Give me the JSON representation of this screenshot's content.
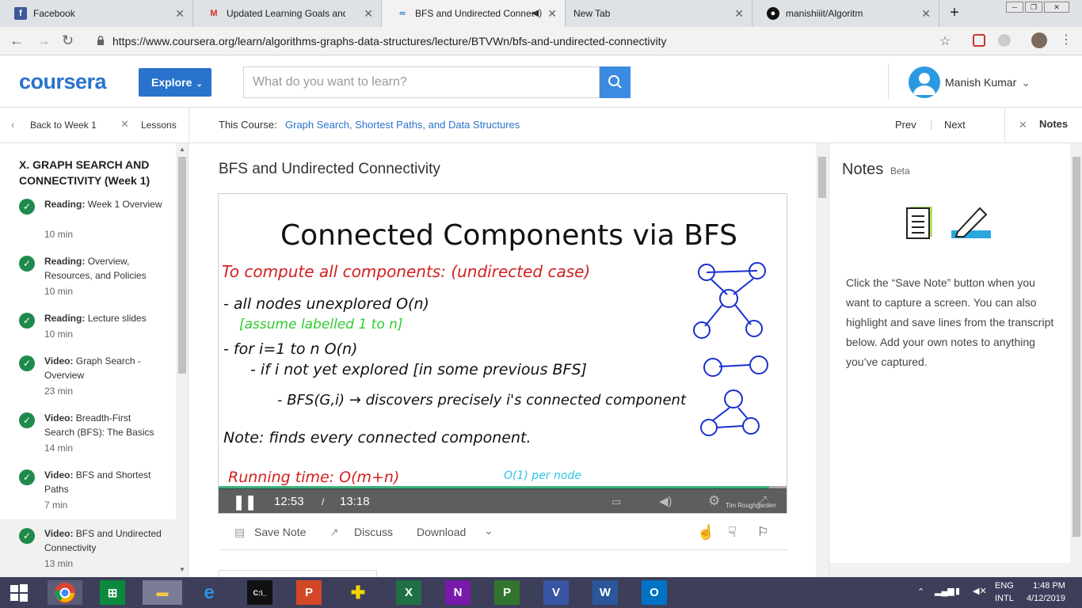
{
  "browser": {
    "tabs": [
      {
        "label": "Facebook",
        "icon": "facebook-icon",
        "color": "#3b5998"
      },
      {
        "label": "Updated Learning Goals and Tin",
        "icon": "gmail-icon",
        "color": "#d93025"
      },
      {
        "label": "BFS and Undirected Connec",
        "icon": "coursera-tab-icon",
        "color": "#2a73cc"
      },
      {
        "label": "New Tab",
        "icon": "newtab-icon",
        "color": "#5f6368"
      },
      {
        "label": "manishiiit/Algoritm",
        "icon": "github-icon",
        "color": "#111111"
      }
    ],
    "url": "https://www.coursera.org/learn/algorithms-graphs-data-structures/lecture/BTVWn/bfs-and-undirected-connectivity"
  },
  "header": {
    "logo": "coursera",
    "explore_label": "Explore",
    "search_placeholder": "What do you want to learn?",
    "user_name": "Manish Kumar",
    "brand_color": "#2a73cc"
  },
  "subnav": {
    "back_label": "Back to Week 1",
    "lessons_label": "Lessons",
    "course_prefix": "This Course:",
    "course_name": "Graph Search, Shortest Paths, and Data Structures",
    "prev_label": "Prev",
    "next_label": "Next",
    "notes_label": "Notes"
  },
  "sidebar": {
    "week_title": "X. GRAPH SEARCH AND CONNECTIVITY (Week 1)",
    "items": [
      {
        "kind": "Reading:",
        "title": "Week 1 Overview",
        "time": "10 min"
      },
      {
        "kind": "Reading:",
        "title": "Overview, Resources, and Policies",
        "time": "10 min"
      },
      {
        "kind": "Reading:",
        "title": "Lecture slides",
        "time": "10 min"
      },
      {
        "kind": "Video:",
        "title": "Graph Search - Overview",
        "time": "23 min"
      },
      {
        "kind": "Video:",
        "title": "Breadth-First Search (BFS): The Basics",
        "time": "14 min"
      },
      {
        "kind": "Video:",
        "title": "BFS and Shortest Paths",
        "time": "7 min"
      },
      {
        "kind": "Video:",
        "title": "BFS and Undirected Connectivity",
        "time": "13 min"
      }
    ]
  },
  "main": {
    "lecture_title": "BFS and Undirected Connectivity",
    "slide": {
      "title": "Connected Components via BFS",
      "lines": [
        {
          "text": "To compute all components: (undirected case)"
        },
        {
          "text": "- all nodes unexplored  O(n)"
        },
        {
          "text": "[assume labelled 1 to n]"
        },
        {
          "text": "- for i=1 to n  O(n)"
        },
        {
          "text": "- if i not yet explored [in some previous BFS]"
        },
        {
          "text": "- BFS(G,i) → discovers precisely i's connected component"
        },
        {
          "text": "Note: finds every connected component."
        },
        {
          "text": "Running time: O(m+n)"
        },
        {
          "text": "O(1) per node"
        }
      ],
      "credit": "Tim Roughgarden"
    },
    "video": {
      "current_time": "12:53",
      "separator": "/",
      "duration": "13:18",
      "progress": 0.969,
      "state": "playing"
    },
    "actions": {
      "save_note": "Save Note",
      "discuss": "Discuss",
      "download": "Download"
    }
  },
  "notes": {
    "title": "Notes",
    "beta": "Beta",
    "text": "Click the “Save Note” button when you want to capture a screen. You can also highlight and save lines from the transcript below. Add your own notes to anything you’ve captured."
  },
  "taskbar": {
    "apps": [
      "windows-start-icon",
      "chrome-icon",
      "store-icon",
      "file-explorer-icon",
      "internet-explorer-icon",
      "cmd-icon",
      "powerpoint-icon",
      "game-icon",
      "excel-icon",
      "onenote-icon",
      "project-icon",
      "visio-icon",
      "word-icon",
      "outlook-icon"
    ],
    "lang_line1": "ENG",
    "lang_line2": "INTL",
    "time": "1:48 PM",
    "date": "4/12/2019"
  }
}
